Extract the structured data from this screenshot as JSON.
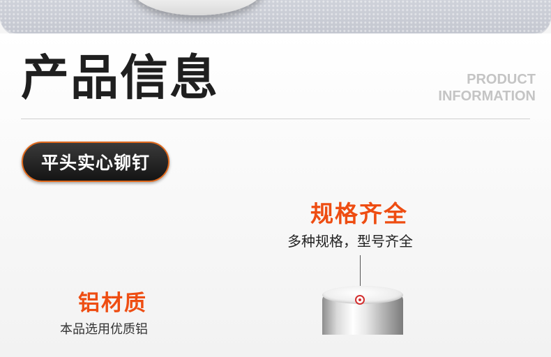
{
  "header": {
    "title_cn": "产品信息",
    "title_en_line1": "PRODUCT",
    "title_en_line2": "INFORMATION"
  },
  "product_name": "平头实心铆钉",
  "features": [
    {
      "title": "规格齐全",
      "description": "多种规格，型号齐全"
    },
    {
      "title": "铝材质",
      "description": "本品选用优质铝"
    }
  ],
  "colors": {
    "accent_orange": "#ee4d12",
    "pill_border": "#e06a1e",
    "pill_background": "#1f1f1f",
    "title_text": "#1f1f1f",
    "english_title": "#c4c4c4",
    "callout_dot": "#d32f2f"
  }
}
